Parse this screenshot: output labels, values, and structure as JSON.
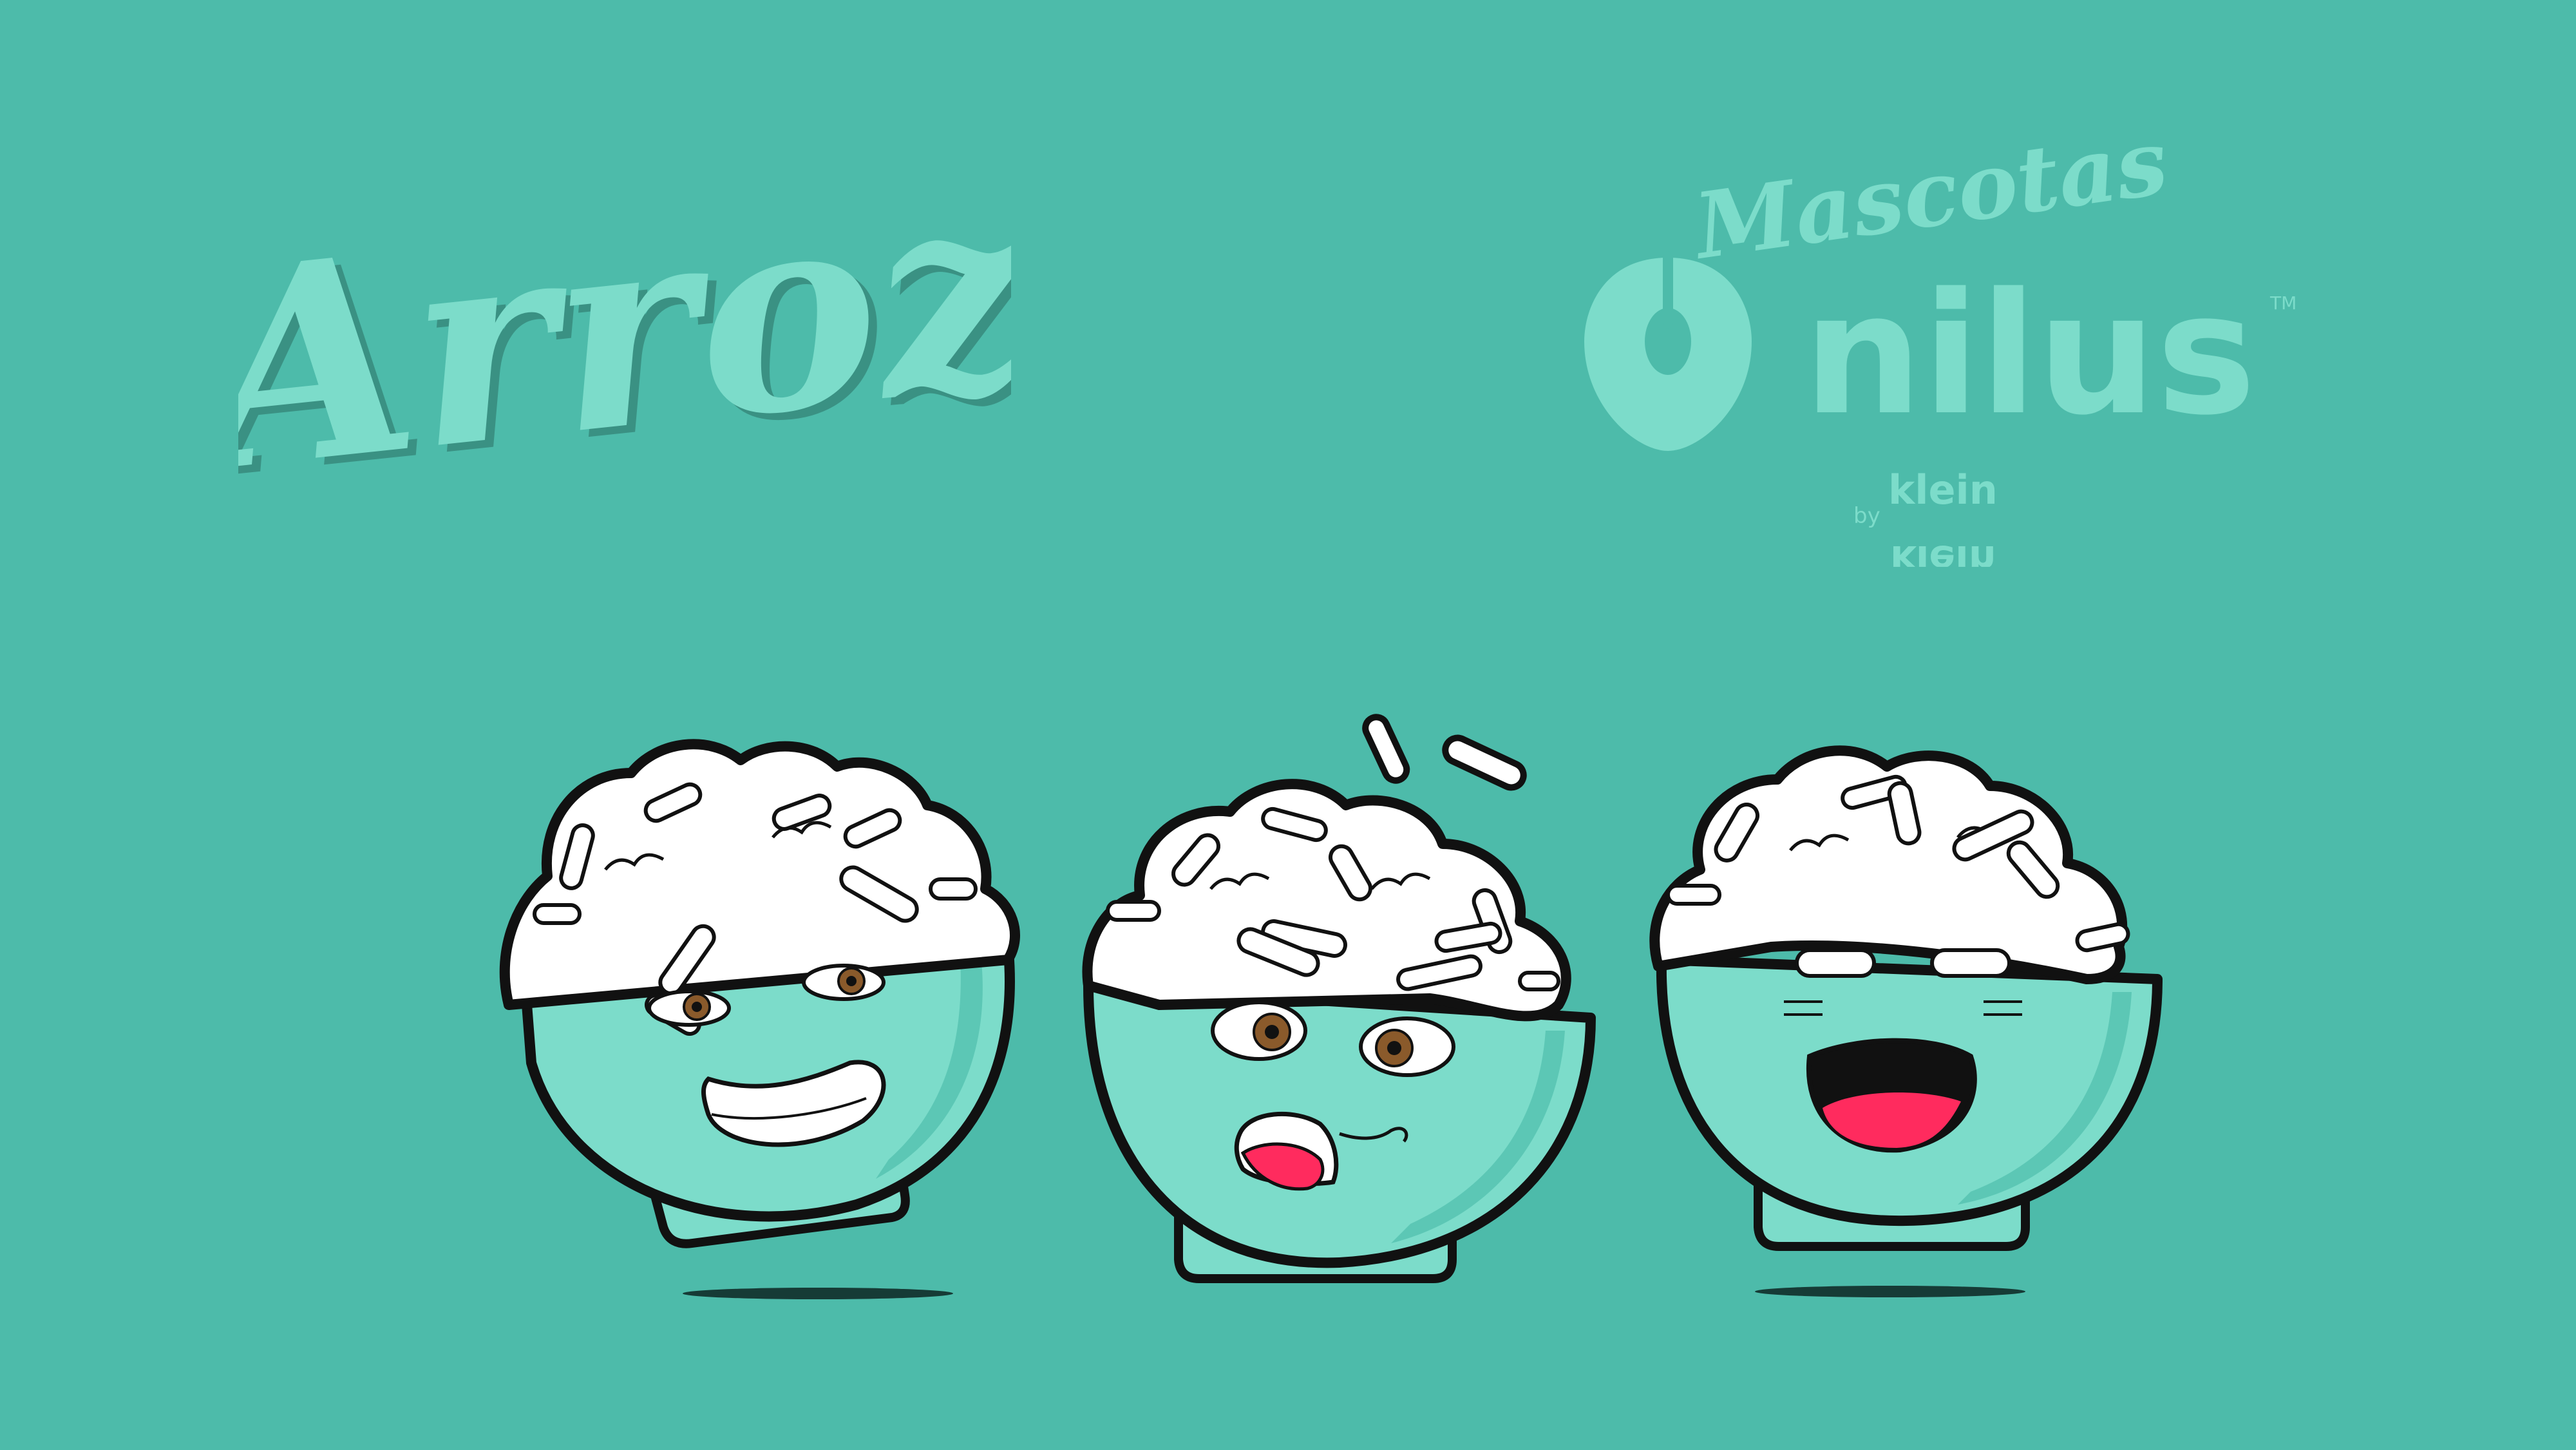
{
  "title": {
    "text": "Arroz"
  },
  "brand": {
    "tagline": "Mascotas",
    "name": "nilus",
    "trademark": "TM",
    "byline": "by",
    "partner": "klein"
  },
  "mascots": [
    {
      "expression": "smirk"
    },
    {
      "expression": "confused"
    },
    {
      "expression": "laughing"
    }
  ],
  "colors": {
    "background": "#4dbbaa",
    "mint": "#7cdcca",
    "mint_dark": "#5cc7b5",
    "outline": "#111111",
    "rice": "#ffffff",
    "iris": "#8a5a2b",
    "mouth_red": "#ff2b5e"
  }
}
